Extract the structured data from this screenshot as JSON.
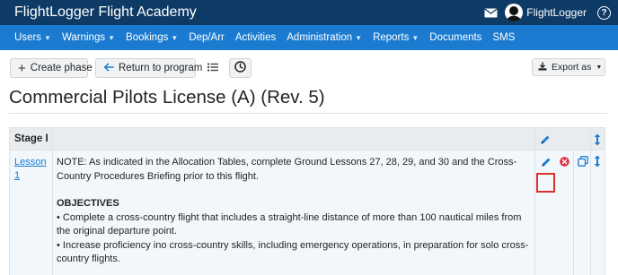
{
  "app": {
    "title": "FlightLogger Flight Academy",
    "user_name": "FlightLogger"
  },
  "nav": {
    "items": [
      {
        "label": "Users",
        "dropdown": true
      },
      {
        "label": "Warnings",
        "dropdown": true
      },
      {
        "label": "Bookings",
        "dropdown": true
      },
      {
        "label": "Dep/Arr",
        "dropdown": false
      },
      {
        "label": "Activities",
        "dropdown": false
      },
      {
        "label": "Administration",
        "dropdown": true
      },
      {
        "label": "Reports",
        "dropdown": true
      },
      {
        "label": "Documents",
        "dropdown": false
      },
      {
        "label": "SMS",
        "dropdown": false
      }
    ]
  },
  "toolbar": {
    "create_phase": "Create phase",
    "return_to_program": "Return to program",
    "export_as": "Export as"
  },
  "page": {
    "title": "Commercial Pilots License (A) (Rev. 5)"
  },
  "table": {
    "stage_header": "Stage I",
    "lesson_link_line1": "Lesson",
    "lesson_link_line2": "1",
    "note": "NOTE: As indicated in the Allocation Tables, complete Ground Lessons 27, 28, 29, and 30 and the Cross-Country Procedures Briefing prior to this flight.",
    "objectives_heading": "OBJECTIVES",
    "objectives": [
      "• Complete a cross-country flight that includes a straight-line distance of more than 100 nautical miles from the original departure point.",
      "• Increase proficiency ino cross-country skills, including emergency operations, in preparation for solo cross-country flights."
    ]
  },
  "colors": {
    "topbar": "#0e3a66",
    "navbar": "#1a7bd0",
    "link": "#1a7bd0",
    "highlight": "#d9322b",
    "delete": "#dc3545"
  }
}
